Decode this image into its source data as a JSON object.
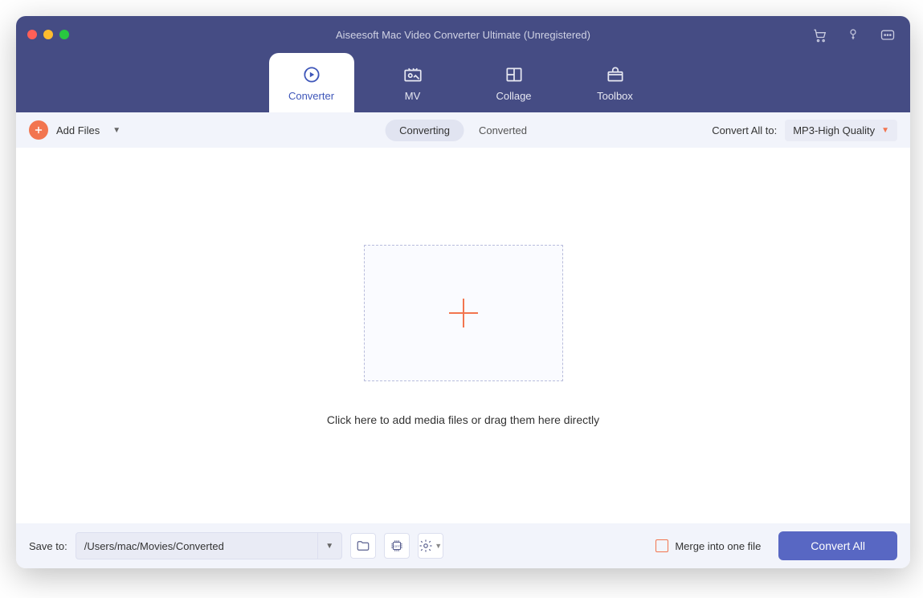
{
  "window": {
    "title": "Aiseesoft Mac Video Converter Ultimate (Unregistered)"
  },
  "titlebar_icons": {
    "cart": "cart-icon",
    "key": "key-icon",
    "feedback": "feedback-icon"
  },
  "tabs": [
    {
      "id": "converter",
      "label": "Converter",
      "active": true
    },
    {
      "id": "mv",
      "label": "MV",
      "active": false
    },
    {
      "id": "collage",
      "label": "Collage",
      "active": false
    },
    {
      "id": "toolbox",
      "label": "Toolbox",
      "active": false
    }
  ],
  "toolbar": {
    "add_files_label": "Add Files",
    "segmented": [
      {
        "id": "converting",
        "label": "Converting",
        "active": true
      },
      {
        "id": "converted",
        "label": "Converted",
        "active": false
      }
    ],
    "convert_all_label": "Convert All to:",
    "format_selected": "MP3-High Quality"
  },
  "dropzone": {
    "hint": "Click here to add media files or drag them here directly"
  },
  "footer": {
    "save_to_label": "Save to:",
    "save_path": "/Users/mac/Movies/Converted",
    "merge_label": "Merge into one file",
    "merge_checked": false,
    "convert_button": "Convert All"
  }
}
